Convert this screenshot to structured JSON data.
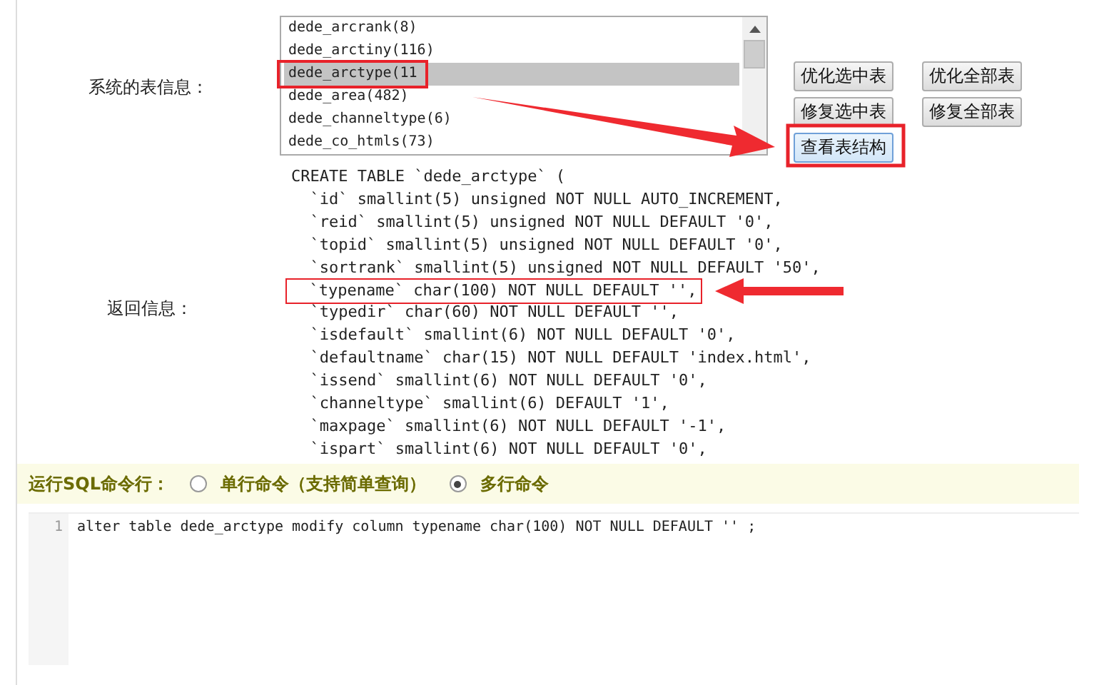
{
  "table_info": {
    "label": "系统的表信息：",
    "tables": [
      {
        "name": "dede_arcrank(8)",
        "selected": false
      },
      {
        "name": "dede_arctiny(116)",
        "selected": false
      },
      {
        "name": "dede_arctype(11",
        "selected": true
      },
      {
        "name": "dede_area(482)",
        "selected": false
      },
      {
        "name": "dede_channeltype(6)",
        "selected": false
      },
      {
        "name": "dede_co_htmls(73)",
        "selected": false
      }
    ],
    "buttons": [
      "优化选中表",
      "优化全部表",
      "修复选中表",
      "修复全部表",
      "查看表结构"
    ]
  },
  "result": {
    "label": "返回信息：",
    "lines": [
      {
        "text": "CREATE TABLE `dede_arctype` (",
        "highlighted": false
      },
      {
        "text": "  `id` smallint(5) unsigned NOT NULL AUTO_INCREMENT,",
        "highlighted": false
      },
      {
        "text": "  `reid` smallint(5) unsigned NOT NULL DEFAULT '0',",
        "highlighted": false
      },
      {
        "text": "  `topid` smallint(5) unsigned NOT NULL DEFAULT '0',",
        "highlighted": false
      },
      {
        "text": "  `sortrank` smallint(5) unsigned NOT NULL DEFAULT '50',",
        "highlighted": false
      },
      {
        "text": "  `typename` char(100) NOT NULL DEFAULT '',",
        "highlighted": true
      },
      {
        "text": "  `typedir` char(60) NOT NULL DEFAULT '',",
        "highlighted": false
      },
      {
        "text": "  `isdefault` smallint(6) NOT NULL DEFAULT '0',",
        "highlighted": false
      },
      {
        "text": "  `defaultname` char(15) NOT NULL DEFAULT 'index.html',",
        "highlighted": false
      },
      {
        "text": "  `issend` smallint(6) NOT NULL DEFAULT '0',",
        "highlighted": false
      },
      {
        "text": "  `channeltype` smallint(6) DEFAULT '1',",
        "highlighted": false
      },
      {
        "text": "  `maxpage` smallint(6) NOT NULL DEFAULT '-1',",
        "highlighted": false
      },
      {
        "text": "  `ispart` smallint(6) NOT NULL DEFAULT '0',",
        "highlighted": false
      }
    ]
  },
  "sql_bar": {
    "label": "运行SQL命令行：",
    "options": [
      {
        "label": "单行命令（支持简单查询）",
        "selected": false
      },
      {
        "label": "多行命令",
        "selected": true
      }
    ]
  },
  "editor": {
    "lines": [
      {
        "number": "1",
        "code": "alter table dede_arctype modify column typename char(100) NOT NULL DEFAULT '' ;"
      }
    ]
  }
}
